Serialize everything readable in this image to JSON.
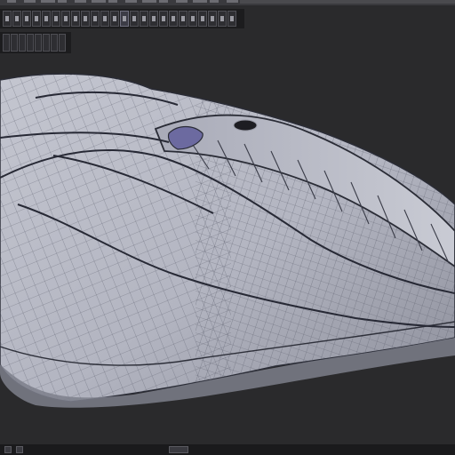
{
  "app": {
    "menu_item_count": 14
  },
  "toolbar": {
    "tools": [
      {
        "icon": "select-icon"
      },
      {
        "icon": "move-icon"
      },
      {
        "icon": "rotate-icon"
      },
      {
        "icon": "scale-icon"
      },
      {
        "icon": "extrude-icon"
      },
      {
        "icon": "loop-cut-icon"
      },
      {
        "icon": "knife-icon"
      },
      {
        "icon": "bevel-icon"
      },
      {
        "icon": "inset-icon"
      },
      {
        "icon": "vertex-icon"
      },
      {
        "icon": "edge-icon"
      },
      {
        "icon": "face-icon"
      },
      {
        "icon": "object-icon"
      },
      {
        "icon": "smooth-icon"
      },
      {
        "icon": "mirror-icon"
      },
      {
        "icon": "snap-icon"
      },
      {
        "icon": "pivot-icon"
      },
      {
        "icon": "proportional-icon"
      },
      {
        "icon": "shading-wire-icon"
      },
      {
        "icon": "shading-solid-icon"
      },
      {
        "icon": "render-icon"
      },
      {
        "icon": "camera-icon"
      },
      {
        "icon": "light-icon"
      },
      {
        "icon": "grid-icon"
      }
    ],
    "active_tool": "object-icon"
  },
  "side_panel": {
    "buttons": [
      {
        "icon": "view-icon"
      },
      {
        "icon": "layer-icon"
      },
      {
        "icon": "outliner-icon"
      },
      {
        "icon": "modifier-icon"
      },
      {
        "icon": "material-icon"
      },
      {
        "icon": "ortho-icon"
      },
      {
        "icon": "persp-icon"
      },
      {
        "icon": "frame-icon"
      }
    ]
  },
  "viewport": {
    "mode": "wireframe-on-shaded",
    "model": "streamlined-hull-mesh",
    "colors": {
      "background": "#2a2a2c",
      "surface": "#b9bbc6",
      "surface_shadow": "#8e909c",
      "wire": "#4a4d5a",
      "crease": "#2a2c36",
      "accent": "#6c6aa0"
    }
  },
  "status_bar": {
    "buttons": [
      {
        "icon": "scene-icon"
      },
      {
        "icon": "layer-toggle-icon"
      },
      {
        "icon": "timeline-icon"
      }
    ]
  }
}
